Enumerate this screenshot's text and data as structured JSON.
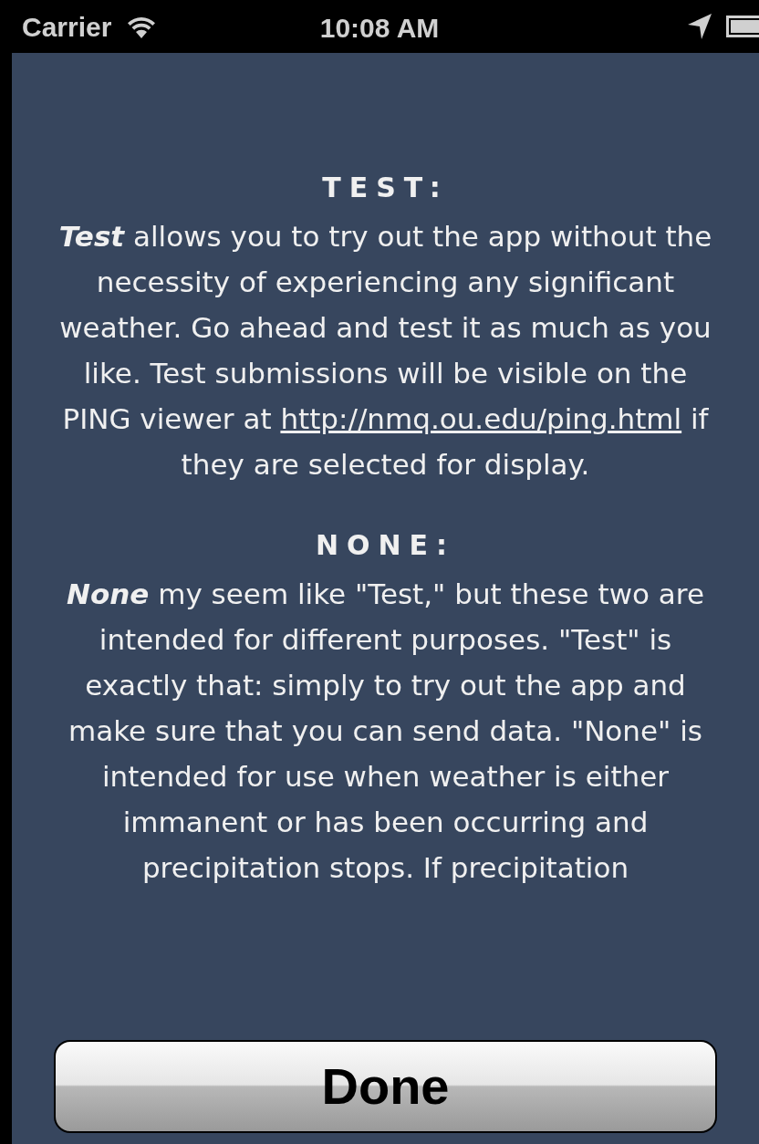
{
  "status_bar": {
    "carrier": "Carrier",
    "time": "10:08 AM"
  },
  "sections": [
    {
      "heading": "TEST:",
      "lead": "Test",
      "text_before": "allows you to try out the app without the necessity of experiencing any significant weather. Go ahead and test it as much as you like. Test submissions will be visible on the PING viewer at",
      "link": "http://nmq.ou.edu/ping.html",
      "text_after": "if they are selected for display."
    },
    {
      "heading": "NONE:",
      "lead": "None",
      "text_before": "my seem like \"Test,\" but these two are intended for different purposes. \"Test\" is exactly that: simply to try out the app and make sure that you can send data. \"None\" is intended for use when weather is either immanent or has been occurring and precipitation stops. If precipitation"
    }
  ],
  "done_button": {
    "label": "Done"
  }
}
